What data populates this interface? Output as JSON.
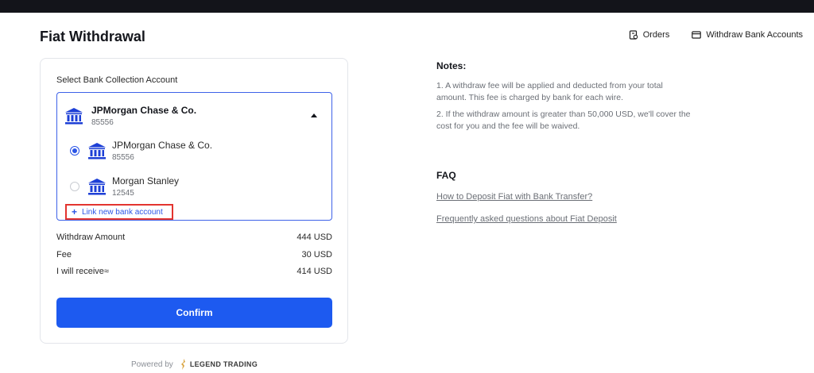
{
  "header": {
    "title": "Fiat Withdrawal",
    "links": [
      {
        "label": "Orders",
        "icon": "orders-icon"
      },
      {
        "label": "Withdraw Bank Accounts",
        "icon": "bank-card-icon"
      }
    ]
  },
  "form": {
    "section_label": "Select Bank Collection Account",
    "selected": {
      "name": "JPMorgan Chase & Co.",
      "number": "85556"
    },
    "options": [
      {
        "name": "JPMorgan Chase & Co.",
        "number": "85556",
        "checked": true
      },
      {
        "name": "Morgan Stanley",
        "number": "12545",
        "checked": false
      }
    ],
    "link_new": "Link new bank account",
    "summary": [
      {
        "label": "Withdraw Amount",
        "value": "444 USD"
      },
      {
        "label": "Fee",
        "value": "30 USD"
      },
      {
        "label": "I will receive≈",
        "value": "414 USD"
      }
    ],
    "confirm_label": "Confirm"
  },
  "footer": {
    "powered_by": "Powered by",
    "brand": "LEGEND TRADING"
  },
  "notes": {
    "title": "Notes:",
    "items": [
      "1. A withdraw fee will be applied and deducted from your total amount. This fee is charged by bank for each wire.",
      "2. If the withdraw amount is greater than 50,000 USD, we'll cover the cost for you and the fee will be waived."
    ]
  },
  "faq": {
    "title": "FAQ",
    "links": [
      "How to Deposit Fiat with Bank Transfer?",
      "Frequently asked questions about Fiat Deposit"
    ]
  },
  "colors": {
    "accent": "#1d5af0",
    "bank_icon": "#1d3fd6",
    "highlight_border": "#e3342f",
    "topbar": "#13141a"
  }
}
